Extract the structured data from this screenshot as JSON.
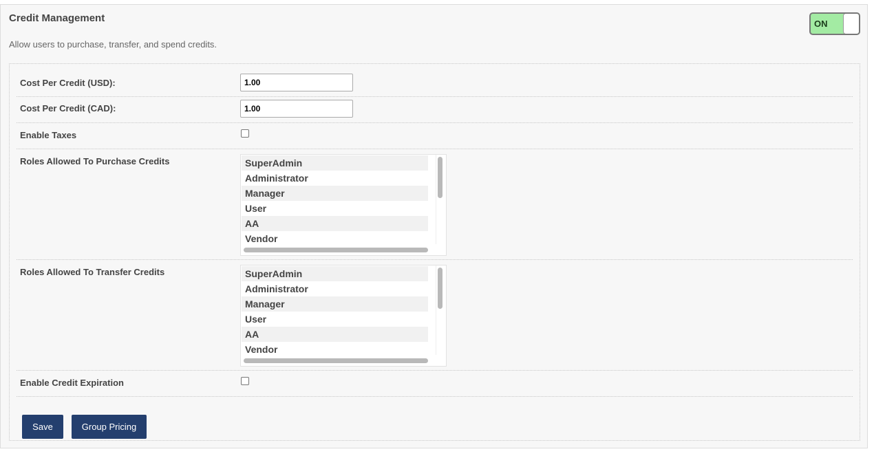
{
  "header": {
    "title": "Credit Management",
    "description": "Allow users to purchase, transfer, and spend credits.",
    "toggle": {
      "state_label": "ON",
      "state": "on"
    }
  },
  "form": {
    "cost_usd": {
      "label": "Cost Per Credit (USD):",
      "value": "1.00"
    },
    "cost_cad": {
      "label": "Cost Per Credit (CAD):",
      "value": "1.00"
    },
    "enable_taxes": {
      "label": "Enable Taxes",
      "checked": false
    },
    "purchase_roles": {
      "label": "Roles Allowed To Purchase Credits",
      "options": [
        "SuperAdmin",
        "Administrator",
        "Manager",
        "User",
        "AA",
        "Vendor"
      ]
    },
    "transfer_roles": {
      "label": "Roles Allowed To Transfer Credits",
      "options": [
        "SuperAdmin",
        "Administrator",
        "Manager",
        "User",
        "AA",
        "Vendor"
      ]
    },
    "enable_expiration": {
      "label": "Enable Credit Expiration",
      "checked": false
    }
  },
  "buttons": {
    "save": "Save",
    "group_pricing": "Group Pricing"
  },
  "colors": {
    "toggle_on": "#a3eba3",
    "button": "#243f6e",
    "panel_bg": "#f7f7f7"
  }
}
